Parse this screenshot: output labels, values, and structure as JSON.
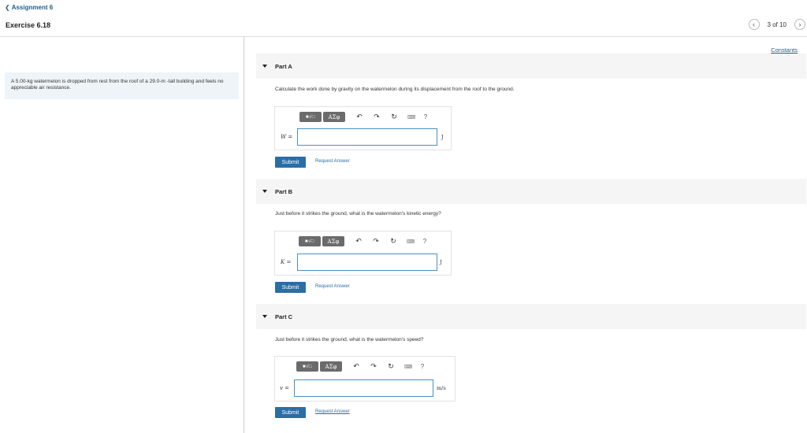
{
  "header": {
    "back_label": "Assignment 6",
    "exercise_title": "Exercise 6.18",
    "pager_text": "3 of 10",
    "constants_link": "Constants"
  },
  "problem": {
    "text": "A 5.00-kg watermelon is dropped from rest from the roof of a 29.0-m -tall building and feels no appreciable air resistance."
  },
  "toolbar": {
    "templates_label": "■√□",
    "symbols_label": "ΑΣφ",
    "undo_icon": "undo-icon",
    "redo_icon": "redo-icon",
    "reset_icon": "reset-icon",
    "keyboard_icon": "keyboard-icon",
    "help_label": "?"
  },
  "parts": [
    {
      "title": "Part A",
      "question": "Calculate the work done by gravity on the watermelon during its displacement from the roof to the ground.",
      "variable": "W =",
      "unit": "J",
      "submit_label": "Submit",
      "request_label": "Request Answer"
    },
    {
      "title": "Part B",
      "question": "Just before it strikes the ground, what is the watermelon's kinetic energy?",
      "variable": "K =",
      "unit": "J",
      "submit_label": "Submit",
      "request_label": "Request Answer"
    },
    {
      "title": "Part C",
      "question": "Just before it strikes the ground, what is the watermelon's speed?",
      "variable": "v =",
      "unit": "m/s",
      "submit_label": "Submit",
      "request_label": "Request Answer"
    }
  ]
}
